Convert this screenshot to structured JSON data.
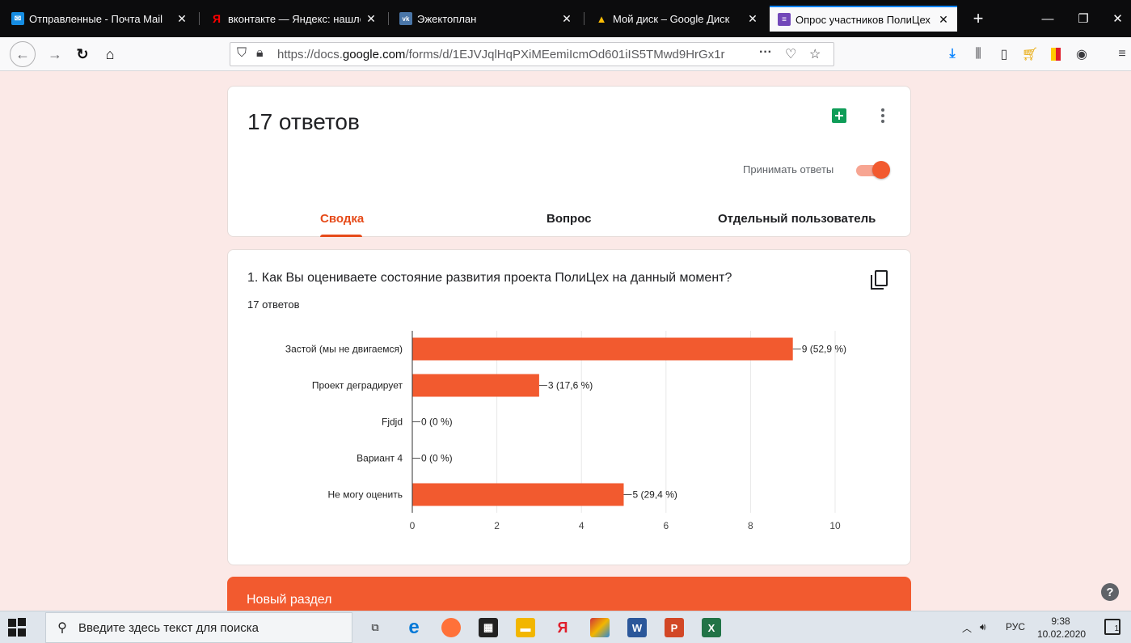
{
  "browser": {
    "tabs": [
      {
        "title": "Отправленные - Почта Mail",
        "favicon_color": "#168de2",
        "favicon": "✉"
      },
      {
        "title": "вконтакте — Яндекс: нашло",
        "favicon_color": "#ff0000",
        "favicon": "Я"
      },
      {
        "title": "Эжектоплан",
        "favicon_color": "#4a76a8",
        "favicon": "vk"
      },
      {
        "title": "Мой диск – Google Диск",
        "favicon_color": "#fbbc04",
        "favicon": "▲"
      },
      {
        "title": "Опрос участников ПолиЦех",
        "favicon_color": "#7248b9",
        "favicon": "≡",
        "active": true
      }
    ],
    "url_prefix": "https://docs.",
    "url_domain": "google.com",
    "url_path": "/forms/d/1EJVJqlHqPXiMEemiIcmOd601iIS5TMwd9HrGx1r"
  },
  "form": {
    "responses_title": "17 ответов",
    "accept_label": "Принимать ответы",
    "tabs": {
      "summary": "Сводка",
      "question": "Вопрос",
      "individual": "Отдельный пользователь"
    },
    "question": {
      "title": "1. Как Вы оцениваете состояние развития проекта ПолиЦех на данный момент?",
      "count": "17 ответов"
    },
    "section_title": "Новый раздел"
  },
  "chart_data": {
    "type": "bar",
    "orientation": "horizontal",
    "categories": [
      "Застой (мы не двигаемся)",
      "Проект деградирует",
      "Fjdjd",
      "Вариант 4",
      "Не могу оценить"
    ],
    "values": [
      9,
      3,
      0,
      0,
      5
    ],
    "data_labels": [
      "9 (52,9 %)",
      "3 (17,6 %)",
      "0 (0 %)",
      "0 (0 %)",
      "5 (29,4 %)"
    ],
    "xlim": [
      0,
      10
    ],
    "xticks": [
      0,
      2,
      4,
      6,
      8,
      10
    ],
    "grid": true,
    "bar_color": "#f25a2f"
  },
  "taskbar": {
    "search_placeholder": "Введите здесь текст для поиска",
    "language": "РУС",
    "time": "9:38",
    "date": "10.02.2020",
    "notification_count": "1"
  }
}
